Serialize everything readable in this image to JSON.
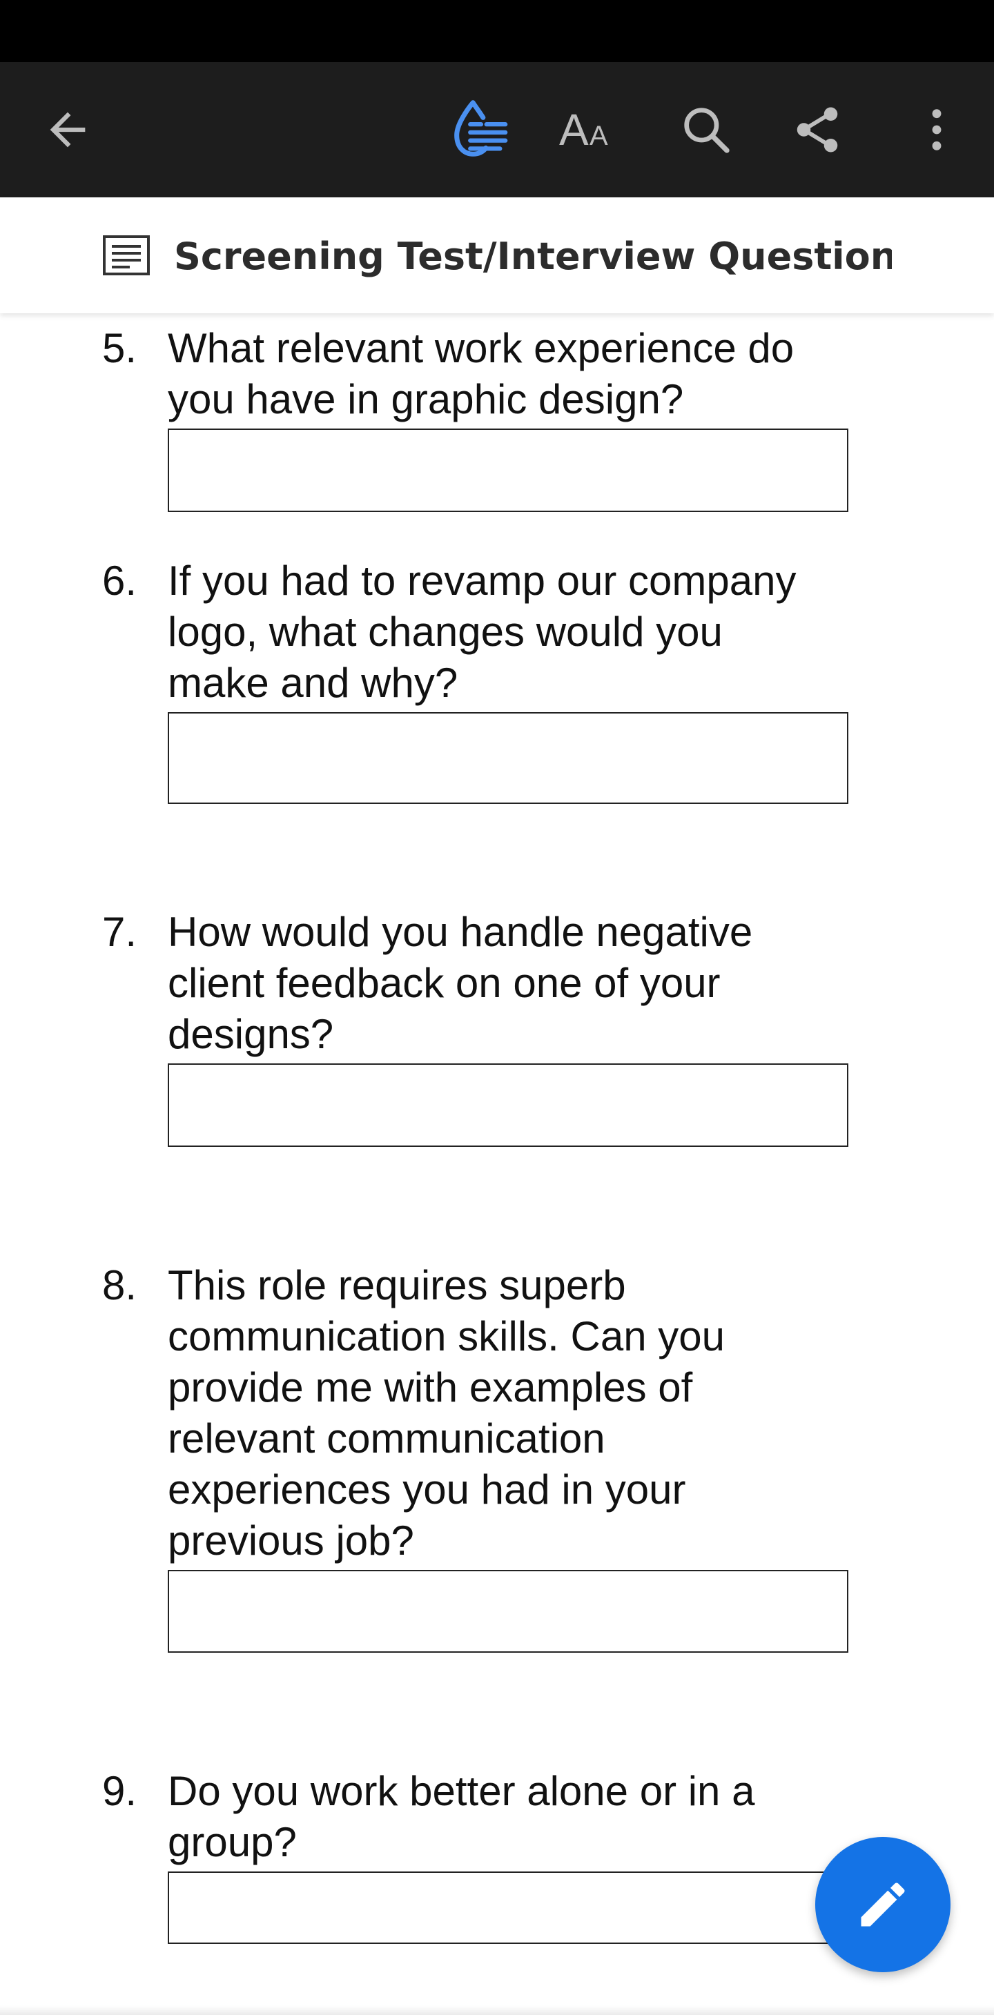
{
  "toolbar": {
    "back_icon": "arrow-left-icon",
    "liquid_mode_icon": "liquid-mode-icon",
    "text_size_label": "AA",
    "search_icon": "search-icon",
    "share_icon": "share-icon",
    "more_icon": "more-vertical-icon",
    "accent_color": "#4a90f0"
  },
  "header": {
    "icon": "document-outline-icon",
    "title": "Screening Test/Interview Questions f..."
  },
  "questions": [
    {
      "number": "5.",
      "lines": [
        "What relevant work experience do",
        "you have in graphic design?"
      ]
    },
    {
      "number": "6.",
      "lines": [
        "If you had to revamp our company",
        "logo, what changes would you",
        "make and why?"
      ]
    },
    {
      "number": "7.",
      "lines": [
        "How would you handle negative",
        "client feedback on one of your",
        "designs?"
      ]
    },
    {
      "number": "8.",
      "lines": [
        "This role requires superb",
        "communication skills. Can you",
        "provide me with examples of",
        "relevant communication",
        "experiences you had in your",
        "previous job?"
      ]
    },
    {
      "number": "9.",
      "lines": [
        "Do you work better alone or in a",
        "group?"
      ]
    }
  ],
  "fab": {
    "icon": "pencil-edit-icon",
    "color": "#1473e6"
  }
}
